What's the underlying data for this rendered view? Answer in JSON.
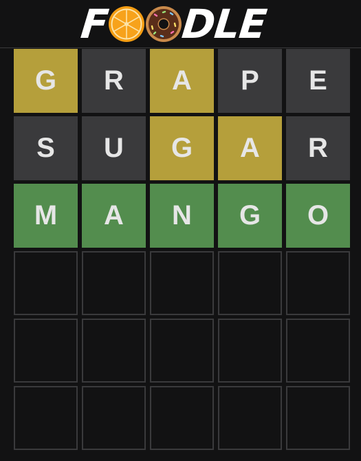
{
  "app": {
    "logo_text_start": "F",
    "logo_text_end": "DLE",
    "logo_icons": [
      "orange-slice-icon",
      "donut-icon"
    ]
  },
  "colors": {
    "background": "#121213",
    "correct": "#538d4e",
    "present": "#b59f3b",
    "absent": "#3a3a3c",
    "empty_border": "#3a3a3c",
    "letter": "#e6e6e6"
  },
  "board": {
    "rows": [
      {
        "tiles": [
          {
            "letter": "G",
            "state": "present"
          },
          {
            "letter": "R",
            "state": "absent"
          },
          {
            "letter": "A",
            "state": "present"
          },
          {
            "letter": "P",
            "state": "absent"
          },
          {
            "letter": "E",
            "state": "absent"
          }
        ]
      },
      {
        "tiles": [
          {
            "letter": "S",
            "state": "absent"
          },
          {
            "letter": "U",
            "state": "absent"
          },
          {
            "letter": "G",
            "state": "present"
          },
          {
            "letter": "A",
            "state": "present"
          },
          {
            "letter": "R",
            "state": "absent"
          }
        ]
      },
      {
        "tiles": [
          {
            "letter": "M",
            "state": "correct"
          },
          {
            "letter": "A",
            "state": "correct"
          },
          {
            "letter": "N",
            "state": "correct"
          },
          {
            "letter": "G",
            "state": "correct"
          },
          {
            "letter": "O",
            "state": "correct"
          }
        ]
      },
      {
        "tiles": [
          {
            "letter": "",
            "state": "empty"
          },
          {
            "letter": "",
            "state": "empty"
          },
          {
            "letter": "",
            "state": "empty"
          },
          {
            "letter": "",
            "state": "empty"
          },
          {
            "letter": "",
            "state": "empty"
          }
        ]
      },
      {
        "tiles": [
          {
            "letter": "",
            "state": "empty"
          },
          {
            "letter": "",
            "state": "empty"
          },
          {
            "letter": "",
            "state": "empty"
          },
          {
            "letter": "",
            "state": "empty"
          },
          {
            "letter": "",
            "state": "empty"
          }
        ]
      },
      {
        "tiles": [
          {
            "letter": "",
            "state": "empty"
          },
          {
            "letter": "",
            "state": "empty"
          },
          {
            "letter": "",
            "state": "empty"
          },
          {
            "letter": "",
            "state": "empty"
          },
          {
            "letter": "",
            "state": "empty"
          }
        ]
      }
    ]
  }
}
